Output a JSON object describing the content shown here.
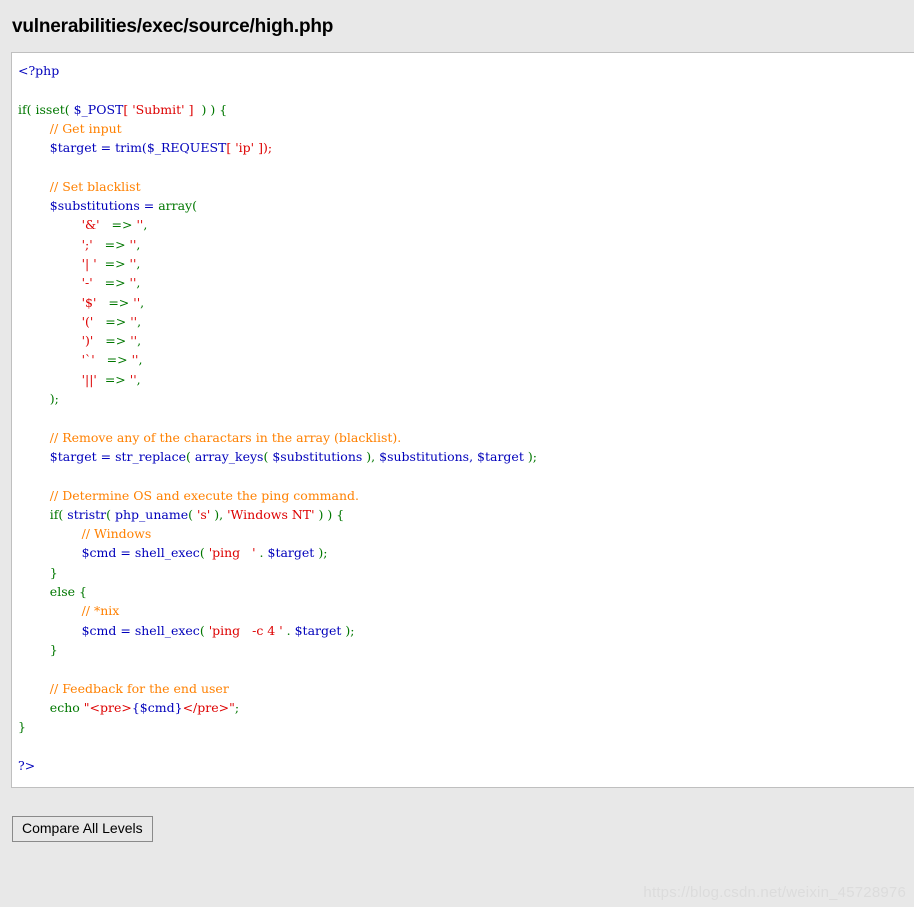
{
  "page": {
    "title": "vulnerabilities/exec/source/high.php",
    "background_color": "#e8e8e8"
  },
  "code_panel": {
    "language": "php",
    "background_color": "#ffffff",
    "border_color": "#bfbfbf",
    "colors": {
      "keyword": "#007700",
      "variable": "#0000bb",
      "string": "#dd0000",
      "comment": "#ff8000",
      "bracket": "#dd0000",
      "default": "#000000"
    },
    "lines": [
      "<?php",
      "",
      "if( isset( $_POST[ 'Submit' ]  ) ) {",
      "    // Get input",
      "    $target = trim($_REQUEST[ 'ip' ]);",
      "",
      "    // Set blacklist",
      "    $substitutions = array(",
      "        '&'  => '',",
      "        ';'  => '',",
      "        '| ' => '',",
      "        '-'  => '',",
      "        '$'  => '',",
      "        '('  => '',",
      "        ')'  => '',",
      "        '`'  => '',",
      "        '||' => '',",
      "    );",
      "",
      "    // Remove any of the charactars in the array (blacklist).",
      "    $target = str_replace( array_keys( $substitutions ), $substitutions, $target );",
      "",
      "    // Determine OS and execute the ping command.",
      "    if( stristr( php_uname( 's' ), 'Windows NT' ) ) {",
      "        // Windows",
      "        $cmd = shell_exec( 'ping  ' . $target );",
      "    }",
      "    else {",
      "        // *nix",
      "        $cmd = shell_exec( 'ping  -c 4 ' . $target );",
      "    }",
      "",
      "    // Feedback for the end user",
      "    echo \"<pre>{$cmd}</pre>\";",
      "}",
      "",
      "?>"
    ]
  },
  "toolbar": {
    "compare_label": "Compare All Levels"
  },
  "watermark": {
    "text": "https://blog.csdn.net/weixin_45728976"
  }
}
